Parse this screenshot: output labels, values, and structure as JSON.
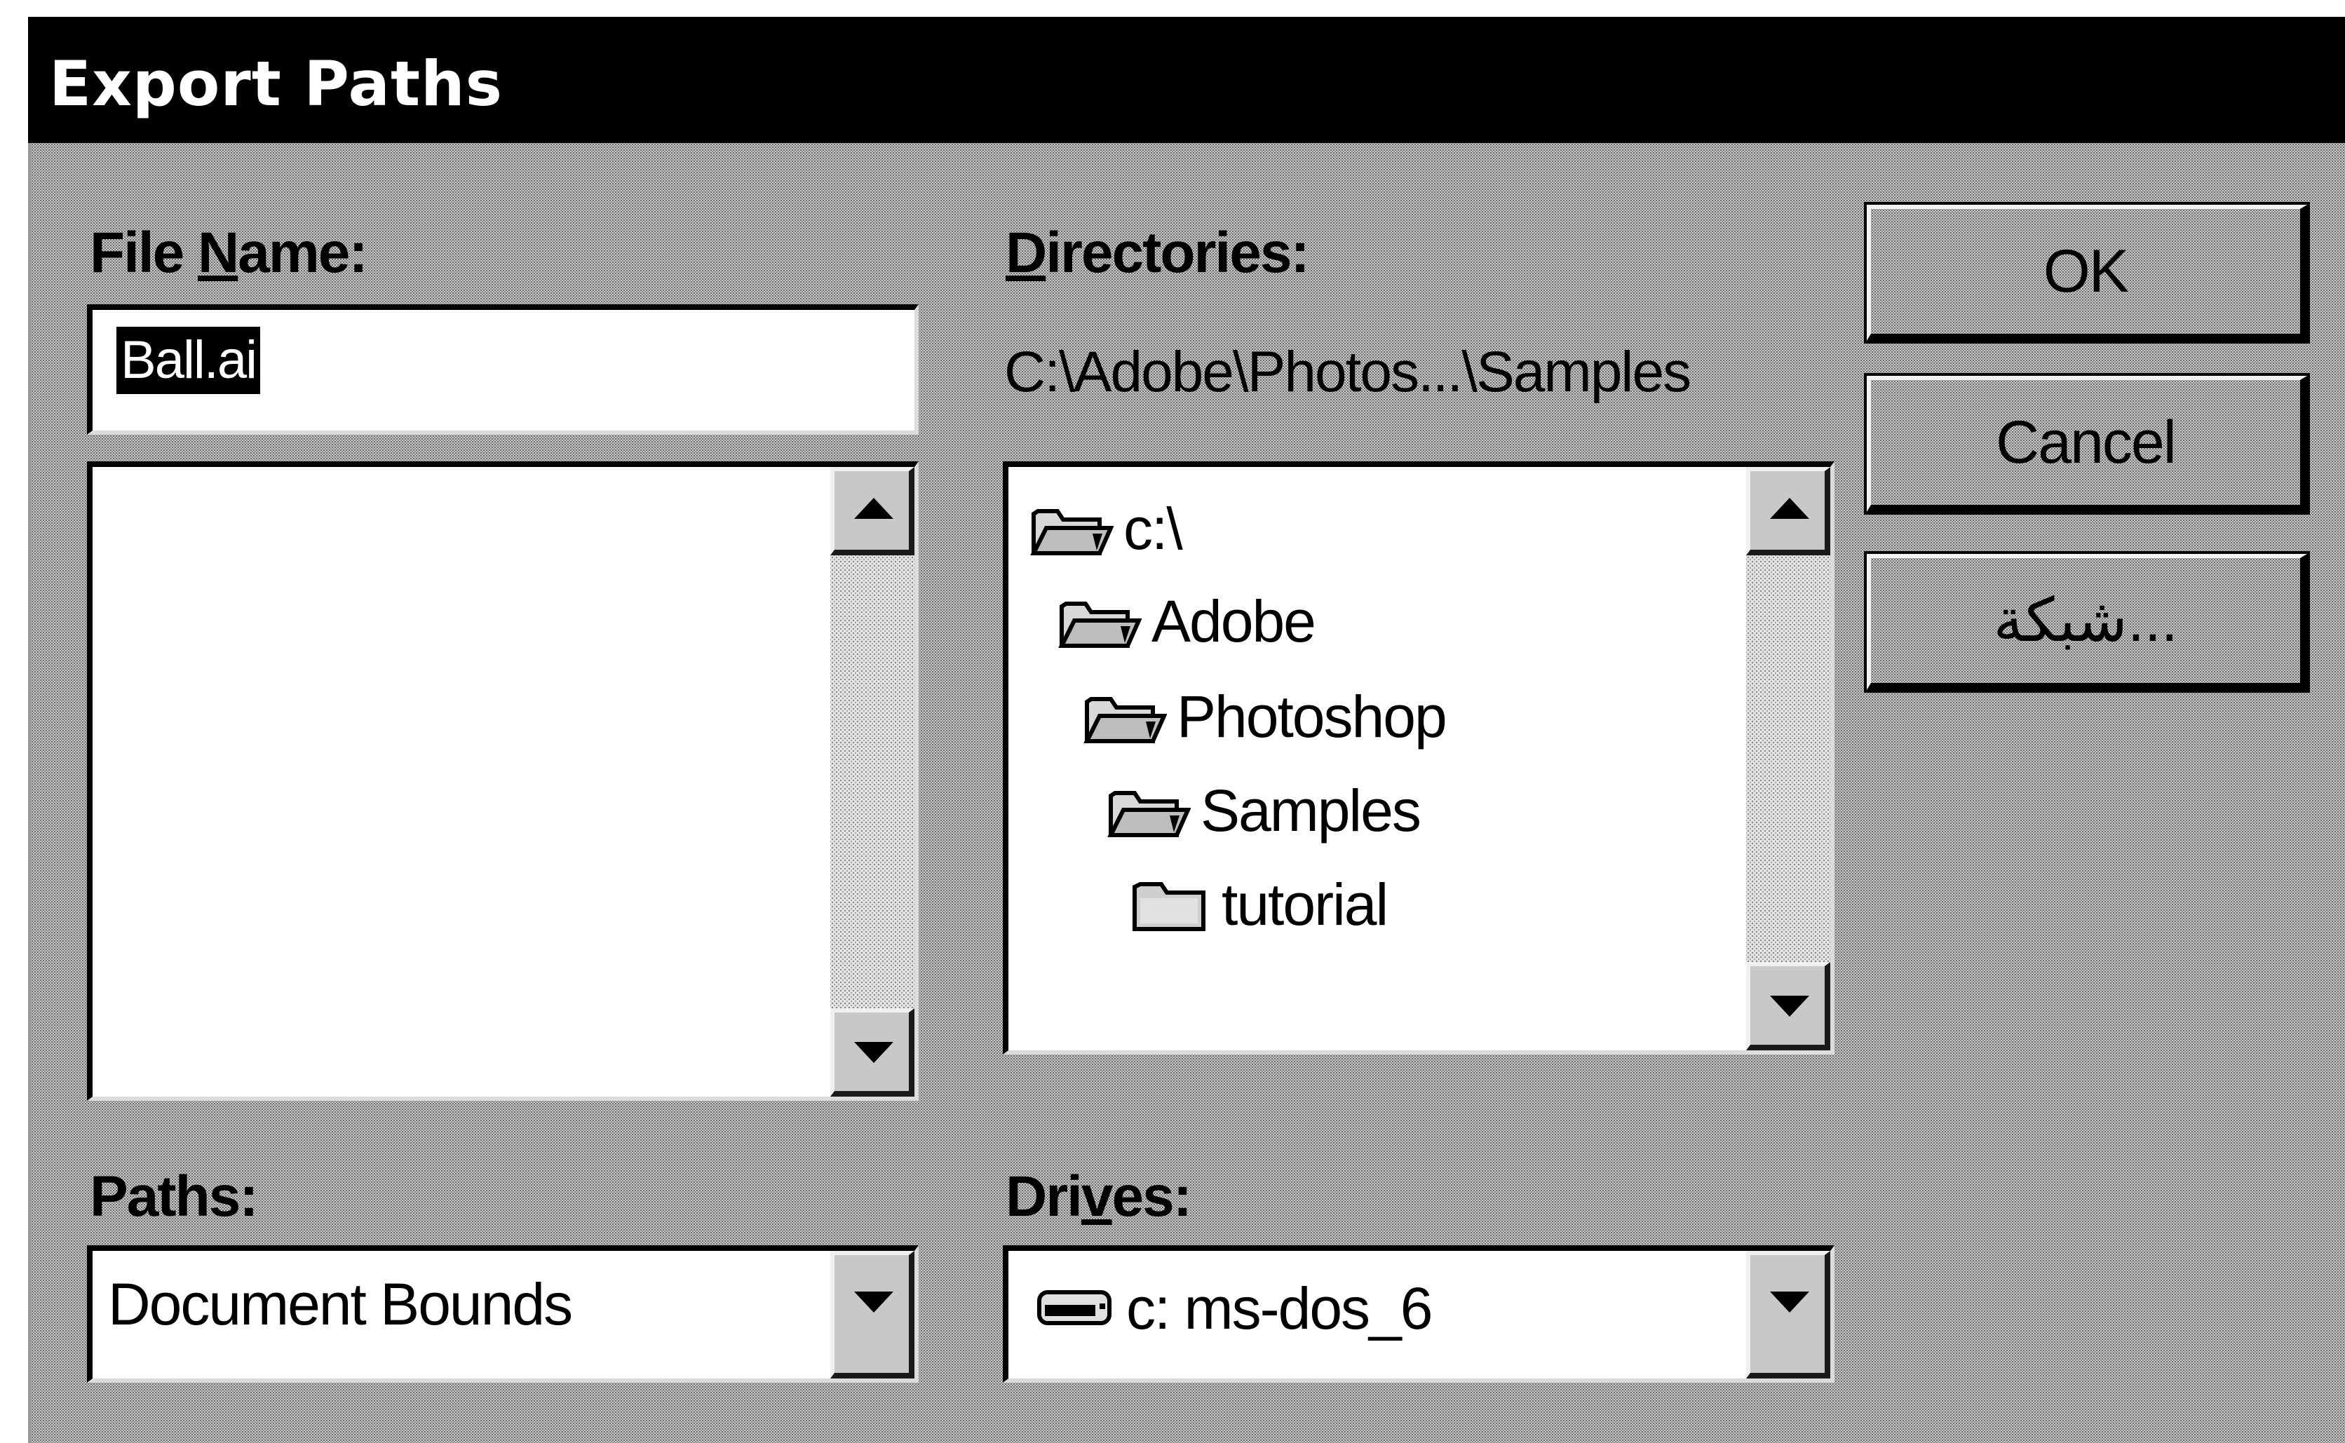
{
  "window": {
    "title": "Export Paths"
  },
  "file_name": {
    "label_prefix": "File ",
    "label_mnemonic": "N",
    "label_suffix": "ame:",
    "value": "Ball.ai"
  },
  "directories": {
    "label_mnemonic": "D",
    "label_suffix": "irectories:",
    "current_path": "C:\\Adobe\\Photos...\\Samples",
    "items": [
      {
        "label": "c:\\",
        "icon": "open-folder-icon"
      },
      {
        "label": "Adobe",
        "icon": "open-folder-icon"
      },
      {
        "label": "Photoshop",
        "icon": "open-folder-icon"
      },
      {
        "label": "Samples",
        "icon": "open-folder-icon"
      },
      {
        "label": "tutorial",
        "icon": "closed-folder-icon"
      }
    ]
  },
  "buttons": {
    "ok": "OK",
    "cancel": "Cancel",
    "network": "شبكة..."
  },
  "paths": {
    "label": "Paths:",
    "selected": "Document Bounds"
  },
  "drives": {
    "label_prefix": "Dri",
    "label_mnemonic": "v",
    "label_suffix": "es:",
    "selected": "c: ms-dos_6",
    "icon": "hard-drive-icon"
  }
}
